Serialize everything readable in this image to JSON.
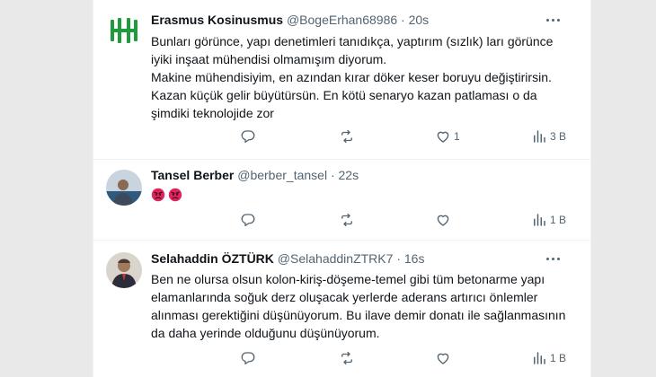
{
  "colors": {
    "icon": "#536471",
    "text": "#0f1419",
    "secondary": "#536471",
    "border": "#eff3f4",
    "avatar1_green": "#1e9b3a"
  },
  "tweets": [
    {
      "name": "Erasmus Kosinusmus",
      "handle": "@BogeErhan68986",
      "dot": "·",
      "time": "20s",
      "avatar_icon": "green-logo-avatar",
      "lines": [
        "Bunları görünce, yapı denetimleri tanıdıkça, yaptırım (sızlık) ları görünce",
        "iyiki inşaat mühendisi olmamışım diyorum.",
        "Makine mühendisiyim, en azından kırar döker keser boruyu değiştirirsin.",
        "Kazan küçük gelir büyütürsün. En kötü senaryo kazan patlaması o da",
        "şimdiki teknolojide zor"
      ],
      "likes": "1",
      "views": "3 B"
    },
    {
      "name": "Tansel Berber",
      "handle": "@berber_tansel",
      "dot": "·",
      "time": "22s",
      "avatar_icon": "photo-avatar",
      "emojis": [
        "angry-face-emoji",
        "angry-face-emoji"
      ],
      "likes": "",
      "views": "1 B"
    },
    {
      "name": "Selahaddin ÖZTÜRK",
      "handle": "@SelahaddinZTRK7",
      "dot": "·",
      "time": "16s",
      "avatar_icon": "photo-avatar",
      "lines": [
        "Ben ne olursa olsun kolon-kiriş-döşeme-temel gibi tüm betonarme yapı",
        "elamanlarında soğuk derz oluşacak yerlerde aderans artırıcı önlemler",
        "alınması gerektiğini düşünüyorum. Bu ilave demir donatı ile sağlanmasının",
        "da daha yerinde olduğunu düşünüyorum."
      ],
      "likes": "",
      "views": "1 B"
    }
  ]
}
